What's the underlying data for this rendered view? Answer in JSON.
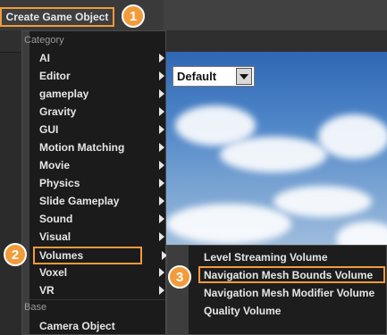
{
  "toolbar": {
    "create_label": "Create Game Object"
  },
  "view_select": {
    "value": "Default"
  },
  "menu": {
    "category_header": "Category",
    "items": [
      {
        "label": "AI"
      },
      {
        "label": "Editor"
      },
      {
        "label": "gameplay"
      },
      {
        "label": "Gravity"
      },
      {
        "label": "GUI"
      },
      {
        "label": "Motion Matching"
      },
      {
        "label": "Movie"
      },
      {
        "label": "Physics"
      },
      {
        "label": "Slide Gameplay"
      },
      {
        "label": "Sound"
      },
      {
        "label": "Visual"
      },
      {
        "label": "Volumes"
      },
      {
        "label": "Voxel"
      },
      {
        "label": "VR"
      }
    ],
    "base_header": "Base",
    "base_items": [
      {
        "label": "Camera Object"
      }
    ]
  },
  "submenu": {
    "items": [
      {
        "label": "Level Streaming Volume"
      },
      {
        "label": "Navigation Mesh Bounds Volume"
      },
      {
        "label": "Navigation Mesh Modifier Volume"
      },
      {
        "label": "Quality Volume"
      }
    ]
  },
  "callouts": [
    "1",
    "2",
    "3"
  ],
  "colors": {
    "accent": "#f29b3b",
    "menu_bg": "#1b1b1b"
  }
}
